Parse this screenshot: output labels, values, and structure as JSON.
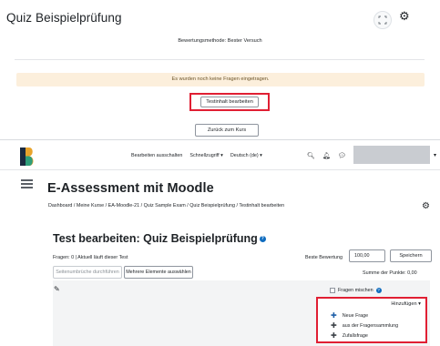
{
  "quiz_view": {
    "title": "Quiz Beispielprüfung",
    "grading_method": "Bewertungsmethode: Bester Versuch",
    "no_questions_notice": "Es wurden noch keine Fragen eingetragen.",
    "edit_button": "Testinhalt bearbeiten",
    "back_button": "Zurück zum Kurs"
  },
  "navbar": {
    "items": [
      "Bearbeiten ausschalten",
      "Schnellzugriff ▾",
      "Deutsch (de) ▾"
    ],
    "icons": [
      "search-icon",
      "bell-icon",
      "chat-icon"
    ]
  },
  "page": {
    "site_title": "E-Assessment mit Moodle",
    "breadcrumb": "Dashboard / Meine Kurse / EA-Moodle-21 / Quiz Sample Exam / Quiz Beispielprüfung / Testinhalt bearbeiten"
  },
  "editor": {
    "heading": "Test bearbeiten: Quiz Beispielprüfung",
    "question_info": "Fragen: 0 | Aktuell läuft dieser Test",
    "max_grade_label": "Beste Bewertung",
    "max_grade_value": "100,00",
    "save_button": "Speichern",
    "repaginate_button": "Seitenumbrüche durchführen",
    "select_multiple_button": "Mehrere Elemente auswählen",
    "total_marks": "Summe der Punkte: 0,00",
    "shuffle_label": "Fragen mischen",
    "add_menu": {
      "label": "Hinzufügen ▾",
      "items": [
        "Neue Frage",
        "aus der Fragensammlung",
        "Zufallsfrage"
      ]
    }
  },
  "colors": {
    "highlight": "#e01f33",
    "help_blue": "#0f6cbf",
    "alert_bg": "#fcefdc",
    "section_bg": "#f3f4f5"
  }
}
